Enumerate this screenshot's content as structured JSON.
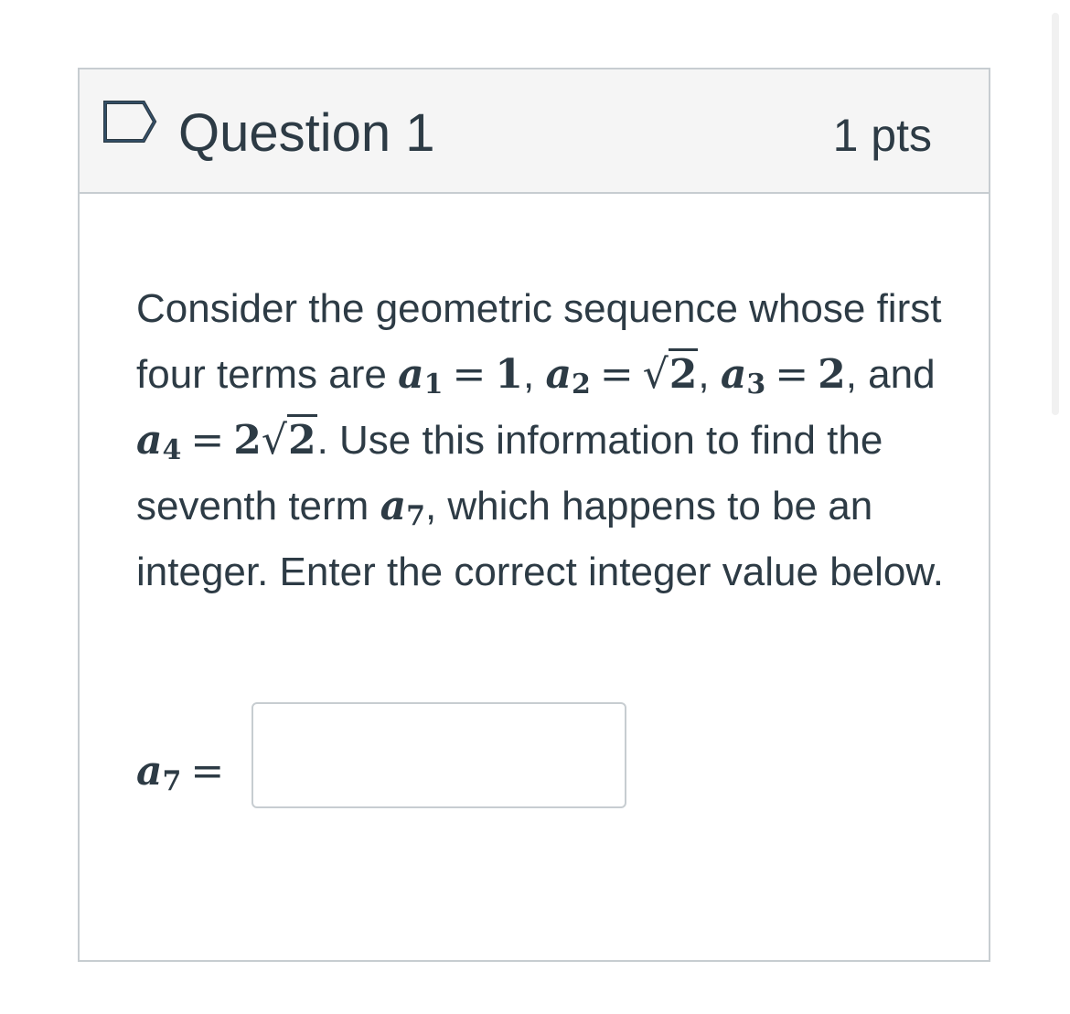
{
  "question": {
    "title": "Question 1",
    "points": "1 pts",
    "flag_icon": "bookmark-flag-icon"
  },
  "text": {
    "p1": "Consider the geometric sequence whose first four terms are ",
    "a1_var": "a",
    "a1_sub": "1",
    "a1_eq": "=",
    "a1_val": "1",
    "sep1": ", ",
    "a2_var": "a",
    "a2_sub": "2",
    "a2_eq": "=",
    "a2_sqrt": "√",
    "a2_rad": "2",
    "sep2": ", ",
    "a3_var": "a",
    "a3_sub": "3",
    "a3_eq": "=",
    "a3_val": "2",
    "sep3": ", and ",
    "a4_var": "a",
    "a4_sub": "4",
    "a4_eq": "=",
    "a4_coef": "2",
    "a4_sqrt": "√",
    "a4_rad": "2",
    "p2": ". Use this information to find the seventh term ",
    "a7_var": "a",
    "a7_sub": "7",
    "p3": ", which happens to be an integer. Enter the correct integer value below."
  },
  "answer": {
    "var": "a",
    "sub": "7",
    "eq": "=",
    "value": "",
    "placeholder": ""
  },
  "colors": {
    "text": "#2d3b45",
    "header_bg": "#f5f5f5",
    "border": "#c7cdd1",
    "flag": "#2d3b45"
  }
}
